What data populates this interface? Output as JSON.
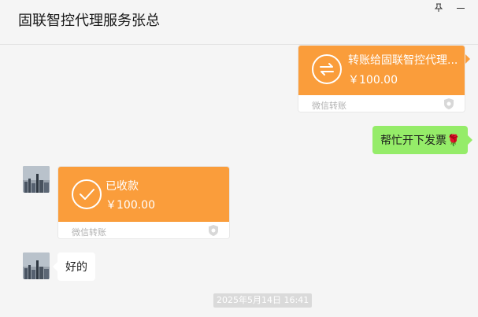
{
  "header": {
    "title": "固联智控代理服务张总",
    "pin_icon": "pin-icon",
    "minimize_icon": "minimize-icon"
  },
  "messages": [
    {
      "type": "transfer-sent",
      "title": "转账给固联智控代理...",
      "amount": "￥100.00",
      "label": "微信转账",
      "icon": "transfer-arrows-icon"
    },
    {
      "type": "text-sent",
      "text": "帮忙开下发票🌹"
    },
    {
      "type": "transfer-received",
      "title": "已收款",
      "amount": "￥100.00",
      "label": "微信转账",
      "icon": "checkmark-icon"
    },
    {
      "type": "text-received",
      "text": "好的"
    }
  ],
  "timestamp": "2025年5月14日 16:41",
  "colors": {
    "transfer_orange": "#fa9d3b",
    "sent_bubble_green": "#95ec69",
    "background": "#f5f5f5"
  }
}
